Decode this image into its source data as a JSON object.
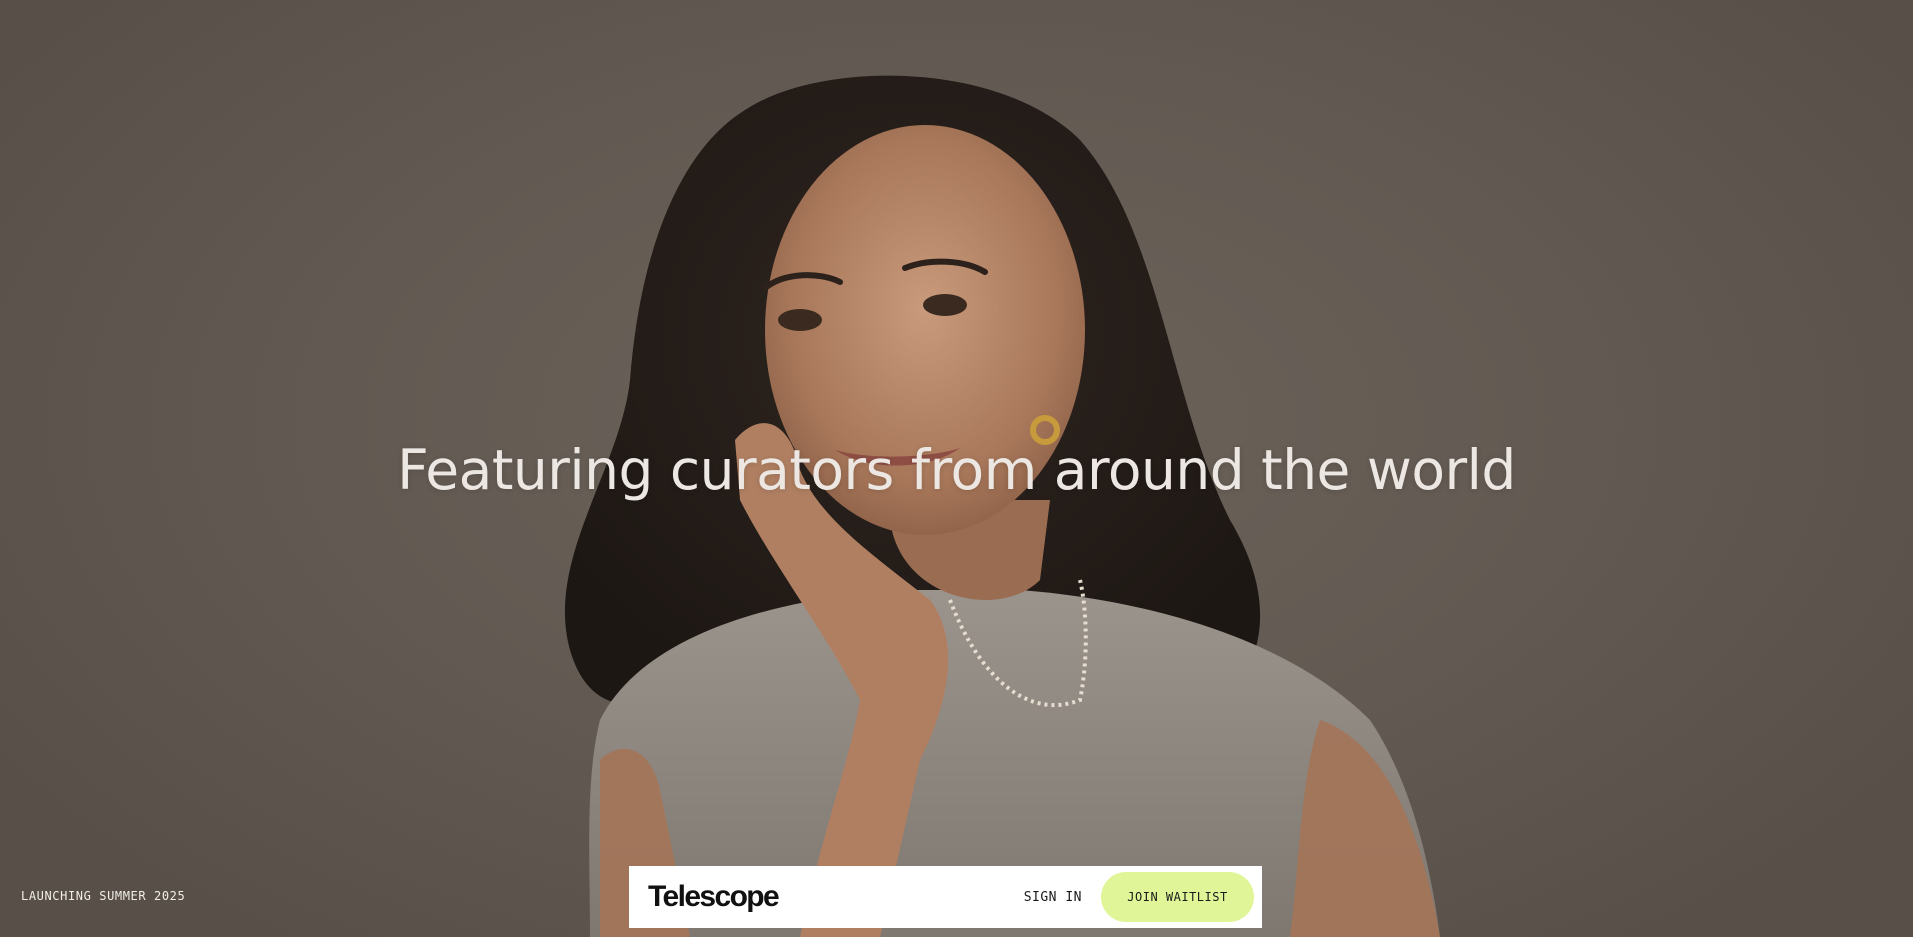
{
  "hero": {
    "headline": "Featuring curators from around the world",
    "image_alt": "Portrait of a smiling woman with curly hair resting her chin on her hand"
  },
  "footer_left": {
    "launch_text": "LAUNCHING SUMMER 2025"
  },
  "navbar": {
    "logo_text": "Telescope",
    "signin_label": "SIGN IN",
    "waitlist_label": "JOIN WAITLIST"
  },
  "colors": {
    "background": "#625a52",
    "accent_button": "#dff597",
    "navbar_bg": "#ffffff",
    "headline_text": "#ece7e2"
  }
}
